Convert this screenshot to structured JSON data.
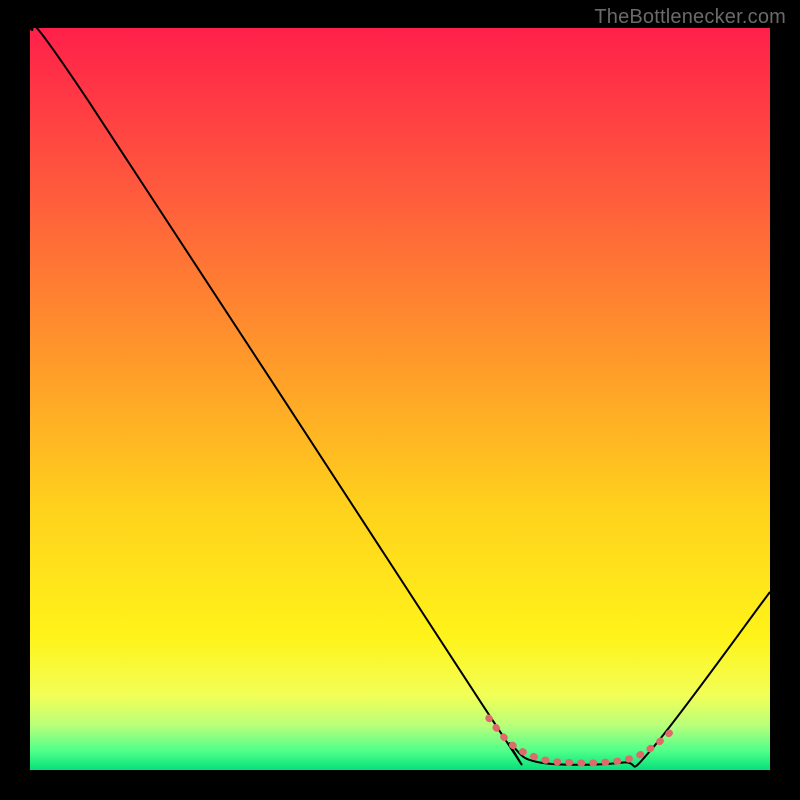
{
  "watermark": "TheBottlenecker.com",
  "chart_data": {
    "type": "line",
    "title": "",
    "xlabel": "",
    "ylabel": "",
    "xlim": [
      0,
      100
    ],
    "ylim": [
      0,
      100
    ],
    "series": [
      {
        "name": "curve",
        "stroke": "#000000",
        "stroke_width": 2,
        "points": [
          {
            "x": 0,
            "y": 100
          },
          {
            "x": 8,
            "y": 90
          },
          {
            "x": 61,
            "y": 9
          },
          {
            "x": 65,
            "y": 3.5
          },
          {
            "x": 69,
            "y": 1.0
          },
          {
            "x": 80,
            "y": 1.0
          },
          {
            "x": 84,
            "y": 2.8
          },
          {
            "x": 100,
            "y": 24
          }
        ]
      },
      {
        "name": "marker-band",
        "stroke": "#de6a6a",
        "stroke_width": 7,
        "dash": [
          1,
          11
        ],
        "points": [
          {
            "x": 62,
            "y": 7.0
          },
          {
            "x": 65,
            "y": 3.5
          },
          {
            "x": 69,
            "y": 1.5
          },
          {
            "x": 73,
            "y": 1.0
          },
          {
            "x": 77,
            "y": 1.0
          },
          {
            "x": 81,
            "y": 1.5
          },
          {
            "x": 84,
            "y": 3.0
          },
          {
            "x": 87,
            "y": 5.5
          }
        ]
      }
    ],
    "gradient_stops": [
      {
        "offset": 0.0,
        "color": "#ff204a"
      },
      {
        "offset": 0.2,
        "color": "#ff553e"
      },
      {
        "offset": 0.45,
        "color": "#ff9a2a"
      },
      {
        "offset": 0.65,
        "color": "#ffd21c"
      },
      {
        "offset": 0.82,
        "color": "#fff31a"
      },
      {
        "offset": 0.9,
        "color": "#f2ff57"
      },
      {
        "offset": 0.94,
        "color": "#b8ff7a"
      },
      {
        "offset": 0.975,
        "color": "#4dff8a"
      },
      {
        "offset": 1.0,
        "color": "#06e07a"
      }
    ]
  }
}
